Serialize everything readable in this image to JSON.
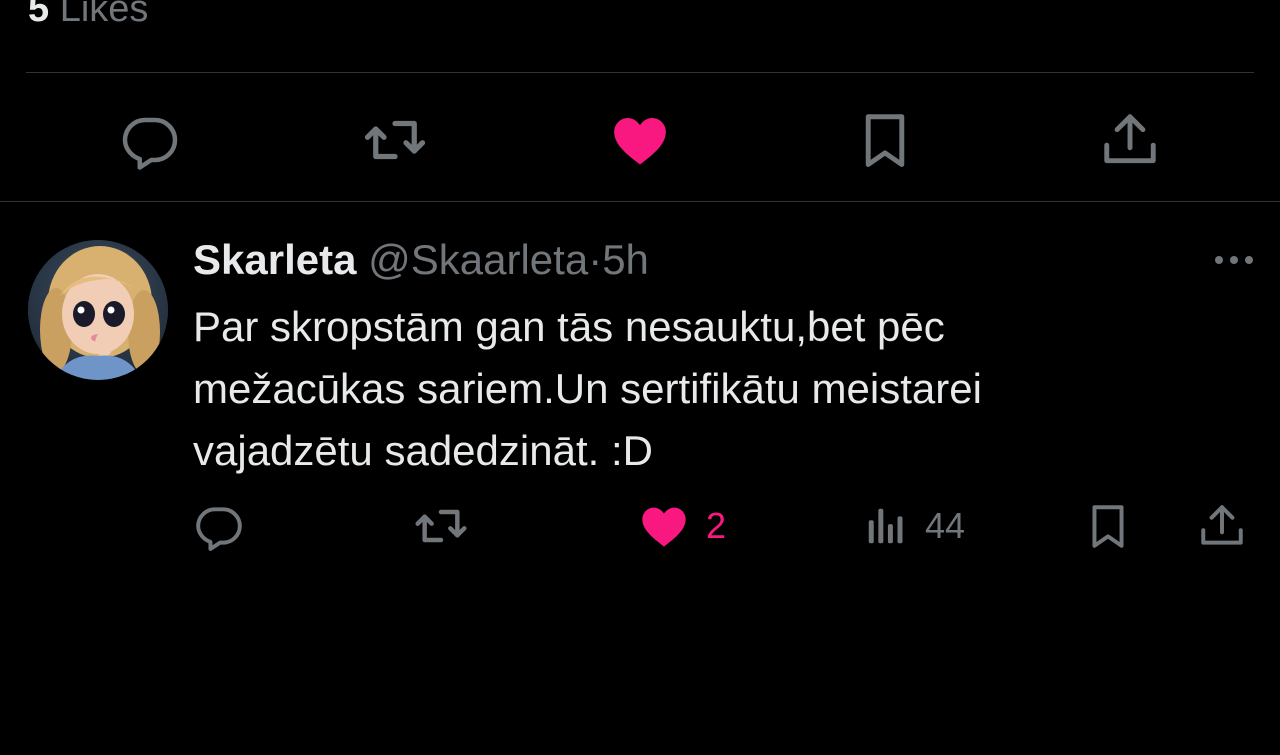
{
  "prev_tweet": {
    "likes_count": "5",
    "likes_label": "Likes"
  },
  "main_actions": [
    {
      "name": "reply-icon",
      "liked": false
    },
    {
      "name": "retweet-icon",
      "liked": false
    },
    {
      "name": "heart-icon",
      "liked": true
    },
    {
      "name": "bookmark-icon",
      "liked": false
    },
    {
      "name": "share-icon",
      "liked": false
    }
  ],
  "reply": {
    "author_name": "Skarleta",
    "handle": "@Skaarleta",
    "separator": "·",
    "time": "5h",
    "text_lines": [
      "Par skropstām gan tās nesauktu,bet pēc",
      "mežacūkas sariem.Un sertifikātu meistarei",
      "vajadzētu sadedzināt. :D"
    ],
    "likes": "2",
    "views": "44",
    "more_icon": "more-dots-icon"
  },
  "colors": {
    "background": "#000000",
    "text": "#e7e9ea",
    "muted": "#71767b",
    "divider": "#2f3336",
    "like_pink": "#f91880"
  }
}
